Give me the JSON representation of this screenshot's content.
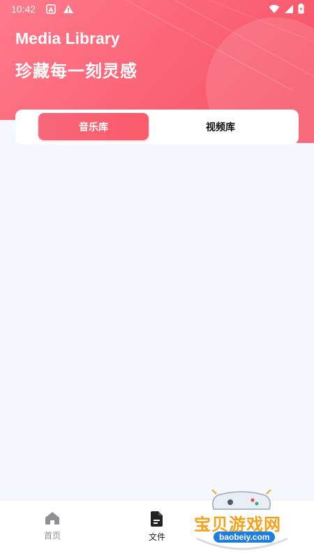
{
  "status_bar": {
    "time": "10:42"
  },
  "header": {
    "title": "Media Library",
    "subtitle": "珍藏每一刻灵感"
  },
  "tabs": {
    "music": "音乐库",
    "video": "视频库",
    "selected": "music"
  },
  "bottom_nav": {
    "home": "首页",
    "files": "文件",
    "selected": "files"
  },
  "watermark": {
    "text": "宝贝游戏网",
    "url": "baobeiy.com"
  },
  "colors": {
    "header_gradient_start": "#ff7688",
    "header_gradient_end": "#f85566",
    "tab_active": "#f9606f",
    "background": "#f4f7fd"
  }
}
